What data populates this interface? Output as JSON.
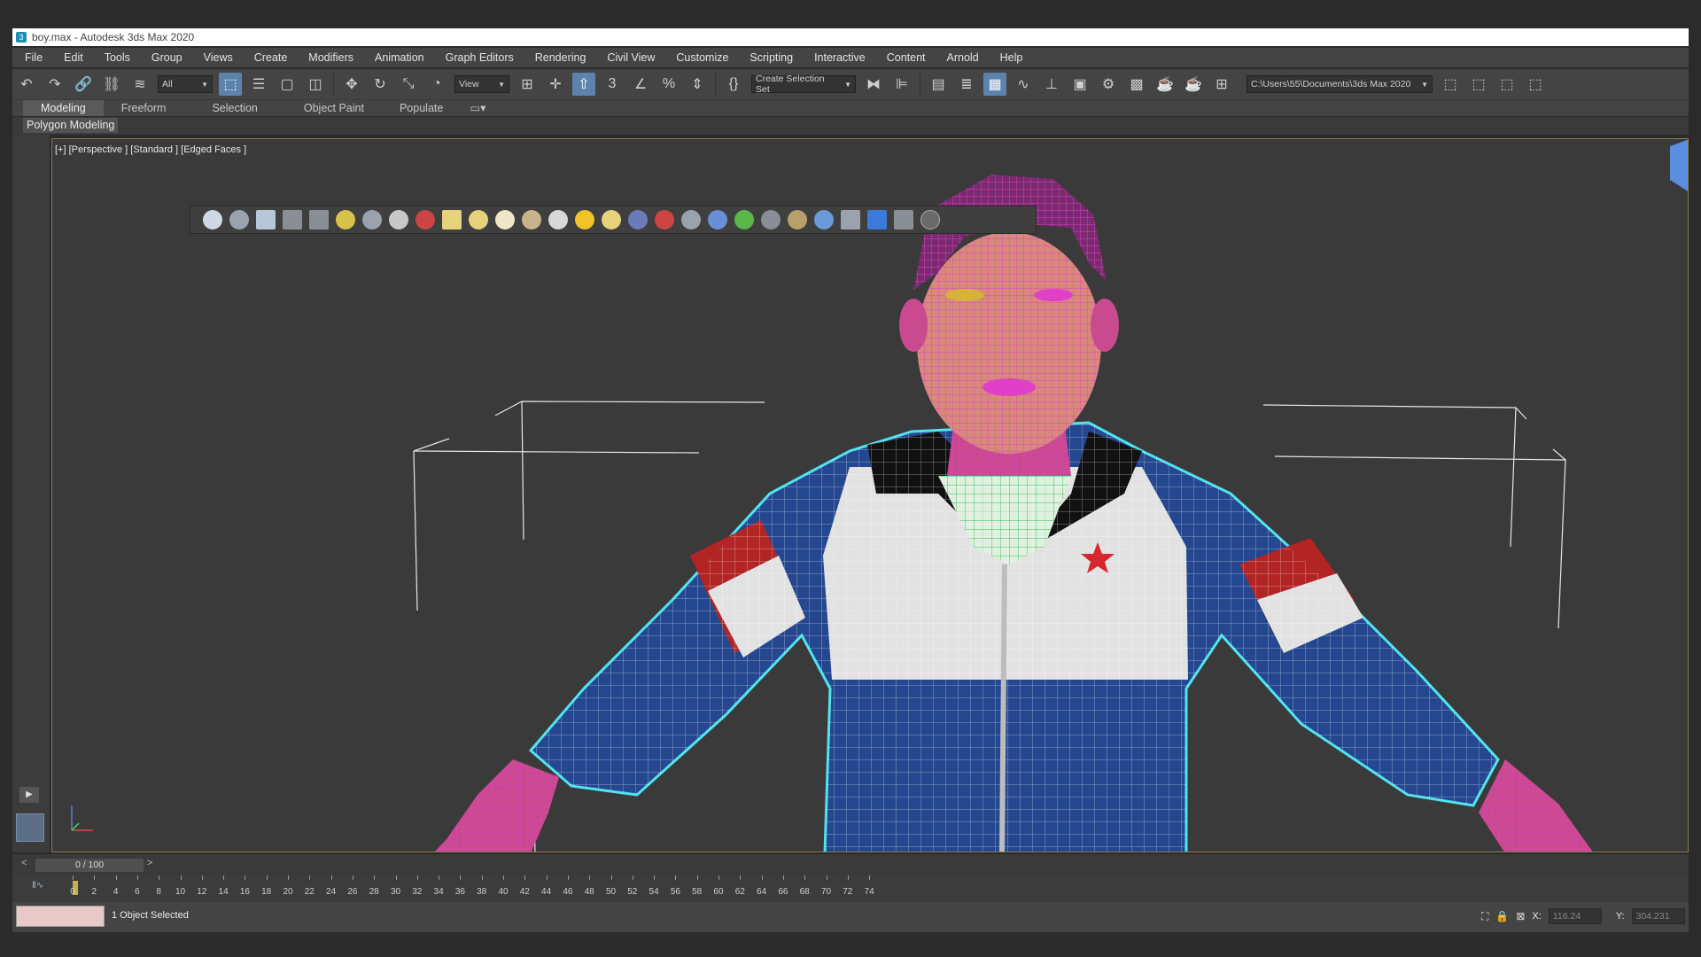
{
  "title": "boy.max - Autodesk 3ds Max 2020",
  "menu": [
    "File",
    "Edit",
    "Tools",
    "Group",
    "Views",
    "Create",
    "Modifiers",
    "Animation",
    "Graph Editors",
    "Rendering",
    "Civil View",
    "Customize",
    "Scripting",
    "Interactive",
    "Content",
    "Arnold",
    "Help"
  ],
  "toolbar": {
    "filter_dropdown": "All",
    "refcoord_dropdown": "View",
    "selection_set": "Create Selection Set",
    "project_path": "C:\\Users\\55\\Documents\\3ds Max 2020"
  },
  "ribbon": {
    "tabs": [
      "Modeling",
      "Freeform",
      "Selection",
      "Object Paint",
      "Populate"
    ],
    "panel_label": "Polygon Modeling"
  },
  "viewport": {
    "label": "[+] [Perspective ] [Standard ] [Edged Faces ]"
  },
  "timeline": {
    "slider_label": "0 / 100",
    "prev": "<",
    "next": ">",
    "ticks": [
      "0",
      "2",
      "4",
      "6",
      "8",
      "10",
      "12",
      "14",
      "16",
      "18",
      "20",
      "22",
      "24",
      "26",
      "28",
      "30",
      "32",
      "34",
      "36",
      "38",
      "40",
      "42",
      "44",
      "46",
      "48",
      "50",
      "52",
      "54",
      "56",
      "58",
      "60",
      "62",
      "64",
      "66",
      "68",
      "70",
      "72",
      "74"
    ]
  },
  "status": {
    "selection": "1 Object Selected",
    "x_label": "X:",
    "x_value": "116.24",
    "y_label": "Y:",
    "y_value": "304.231"
  },
  "colors": {
    "accent": "#5d83ad",
    "wire_skin": "#e040c8",
    "wire_jacket": "#ffffff",
    "selection_outline": "#4fe3f0",
    "jacket_blue": "#24478f",
    "jacket_red": "#b32424"
  }
}
